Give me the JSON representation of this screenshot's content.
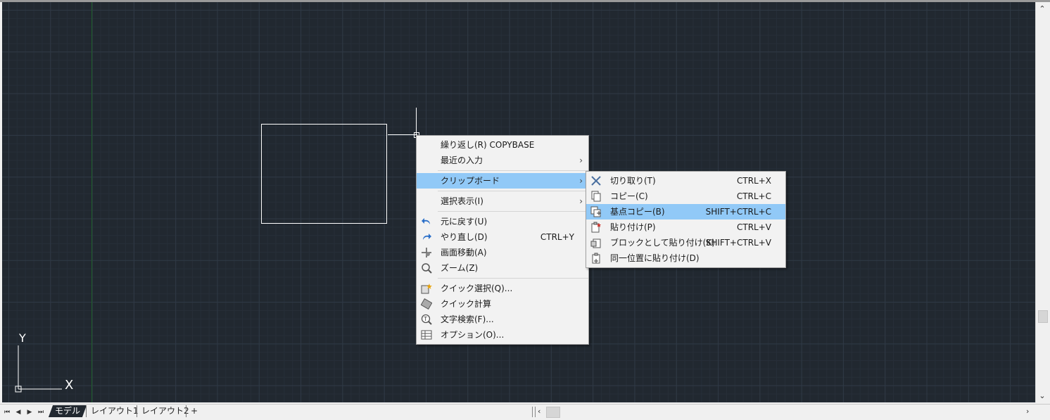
{
  "layout_tabs": [
    "モデル",
    "レイアウト1",
    "レイアウト2"
  ],
  "add_tab": "+",
  "ucs": {
    "x_label": "X",
    "y_label": "Y"
  },
  "context_menu": {
    "items": [
      {
        "label": "繰り返し(R) COPYBASE"
      },
      {
        "label": "最近の入力",
        "submenu": true
      },
      {
        "label": "クリップボード",
        "submenu": true,
        "highlighted": true
      },
      {
        "label": "選択表示(I)",
        "submenu": true
      },
      {
        "label": "元に戻す(U)",
        "icon": "undo-icon"
      },
      {
        "label": "やり直し(D)",
        "shortcut": "CTRL+Y",
        "icon": "redo-icon"
      },
      {
        "label": "画面移動(A)",
        "icon": "pan-icon"
      },
      {
        "label": "ズーム(Z)",
        "icon": "zoom-icon"
      },
      {
        "label": "クイック選択(Q)...",
        "icon": "quick-select-icon"
      },
      {
        "label": "クイック計算",
        "icon": "quick-calc-icon"
      },
      {
        "label": "文字検索(F)...",
        "icon": "find-text-icon"
      },
      {
        "label": "オプション(O)...",
        "icon": "options-icon"
      }
    ],
    "submenu_arrow": "›"
  },
  "clipboard_submenu": {
    "items": [
      {
        "label": "切り取り(T)",
        "shortcut": "CTRL+X",
        "icon": "cut-icon"
      },
      {
        "label": "コピー(C)",
        "shortcut": "CTRL+C",
        "icon": "copy-icon"
      },
      {
        "label": "基点コピー(B)",
        "shortcut": "SHIFT+CTRL+C",
        "icon": "copy-with-basepoint-icon",
        "highlighted": true
      },
      {
        "label": "貼り付け(P)",
        "shortcut": "CTRL+V",
        "icon": "paste-icon"
      },
      {
        "label": "ブロックとして貼り付け(K)",
        "shortcut": "SHIFT+CTRL+V",
        "icon": "paste-as-block-icon"
      },
      {
        "label": "同一位置に貼り付け(D)",
        "icon": "paste-to-original-icon"
      }
    ]
  },
  "colors": {
    "canvas": "#212830",
    "highlight": "#91c9f7",
    "grid_major": "#2f3945"
  }
}
